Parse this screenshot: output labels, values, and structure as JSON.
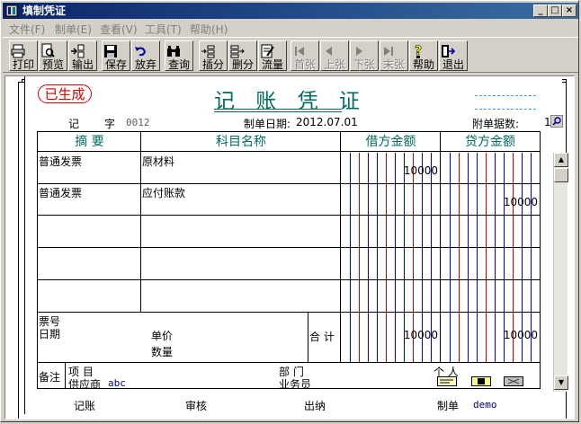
{
  "window": {
    "title": "填制凭证",
    "controls": {
      "minimize": "_",
      "maximize": "□",
      "close": "×"
    }
  },
  "menu": [
    {
      "label": "文件(F)"
    },
    {
      "label": "制单(E)"
    },
    {
      "label": "查看(V)"
    },
    {
      "label": "工具(T)"
    },
    {
      "label": "帮助(H)"
    }
  ],
  "toolbar": [
    {
      "label": "打印",
      "icon": "printer-icon",
      "enabled": true
    },
    {
      "label": "预览",
      "icon": "preview-icon",
      "enabled": true
    },
    {
      "label": "输出",
      "icon": "export-icon",
      "enabled": true
    },
    {
      "label": "保存",
      "icon": "save-icon",
      "enabled": true
    },
    {
      "label": "放弃",
      "icon": "undo-icon",
      "enabled": true
    },
    {
      "label": "查询",
      "icon": "binoculars-icon",
      "enabled": true
    },
    {
      "label": "插分",
      "icon": "insert-row-icon",
      "enabled": true
    },
    {
      "label": "删分",
      "icon": "delete-row-icon",
      "enabled": true
    },
    {
      "label": "流量",
      "icon": "cashflow-icon",
      "enabled": true
    },
    {
      "label": "首张",
      "icon": "first-icon",
      "enabled": false
    },
    {
      "label": "上张",
      "icon": "prev-icon",
      "enabled": false
    },
    {
      "label": "下张",
      "icon": "next-icon",
      "enabled": false
    },
    {
      "label": "末张",
      "icon": "last-icon",
      "enabled": false
    },
    {
      "label": "帮助",
      "icon": "help-icon",
      "enabled": true
    },
    {
      "label": "退出",
      "icon": "exit-icon",
      "enabled": true
    }
  ],
  "voucher": {
    "stamp": "已生成",
    "title": "记 账 凭 证",
    "word_label": "记",
    "number_label": "字",
    "number": "0012",
    "date_label": "制单日期:",
    "date": "2012.07.01",
    "attachments_label": "附单据数:",
    "attachments": "1",
    "columns": {
      "summary": "摘 要",
      "account": "科目名称",
      "debit": "借方金额",
      "credit": "贷方金额"
    },
    "rows": [
      {
        "summary": "普通发票",
        "account": "原材料",
        "debit": "10000",
        "credit": ""
      },
      {
        "summary": "普通发票",
        "account": "应付账款",
        "debit": "",
        "credit": "10000"
      },
      {
        "summary": "",
        "account": "",
        "debit": "",
        "credit": ""
      },
      {
        "summary": "",
        "account": "",
        "debit": "",
        "credit": ""
      },
      {
        "summary": "",
        "account": "",
        "debit": "",
        "credit": ""
      }
    ],
    "ticket_no_label": "票号",
    "date_field_label": "日期",
    "unit_price_label": "单价",
    "quantity_label": "数量",
    "total_label": "合 计",
    "total_debit": "10000",
    "total_credit": "10000",
    "remarks_label": "备注",
    "project_label": "项 目",
    "department_label": "部 门",
    "person_label": "个 人",
    "supplier_label": "供应商",
    "supplier": "abc",
    "salesman_label": "业务员",
    "bookkeeper_label": "记账",
    "auditor_label": "审核",
    "cashier_label": "出纳",
    "maker_label": "制单",
    "maker": "demo"
  },
  "colors": {
    "title_bar": "#0a246a",
    "voucher_title": "#006b5f",
    "stamp": "#d00000",
    "debit_lines": "#0000cc",
    "credit_lines": "#cc0000"
  }
}
